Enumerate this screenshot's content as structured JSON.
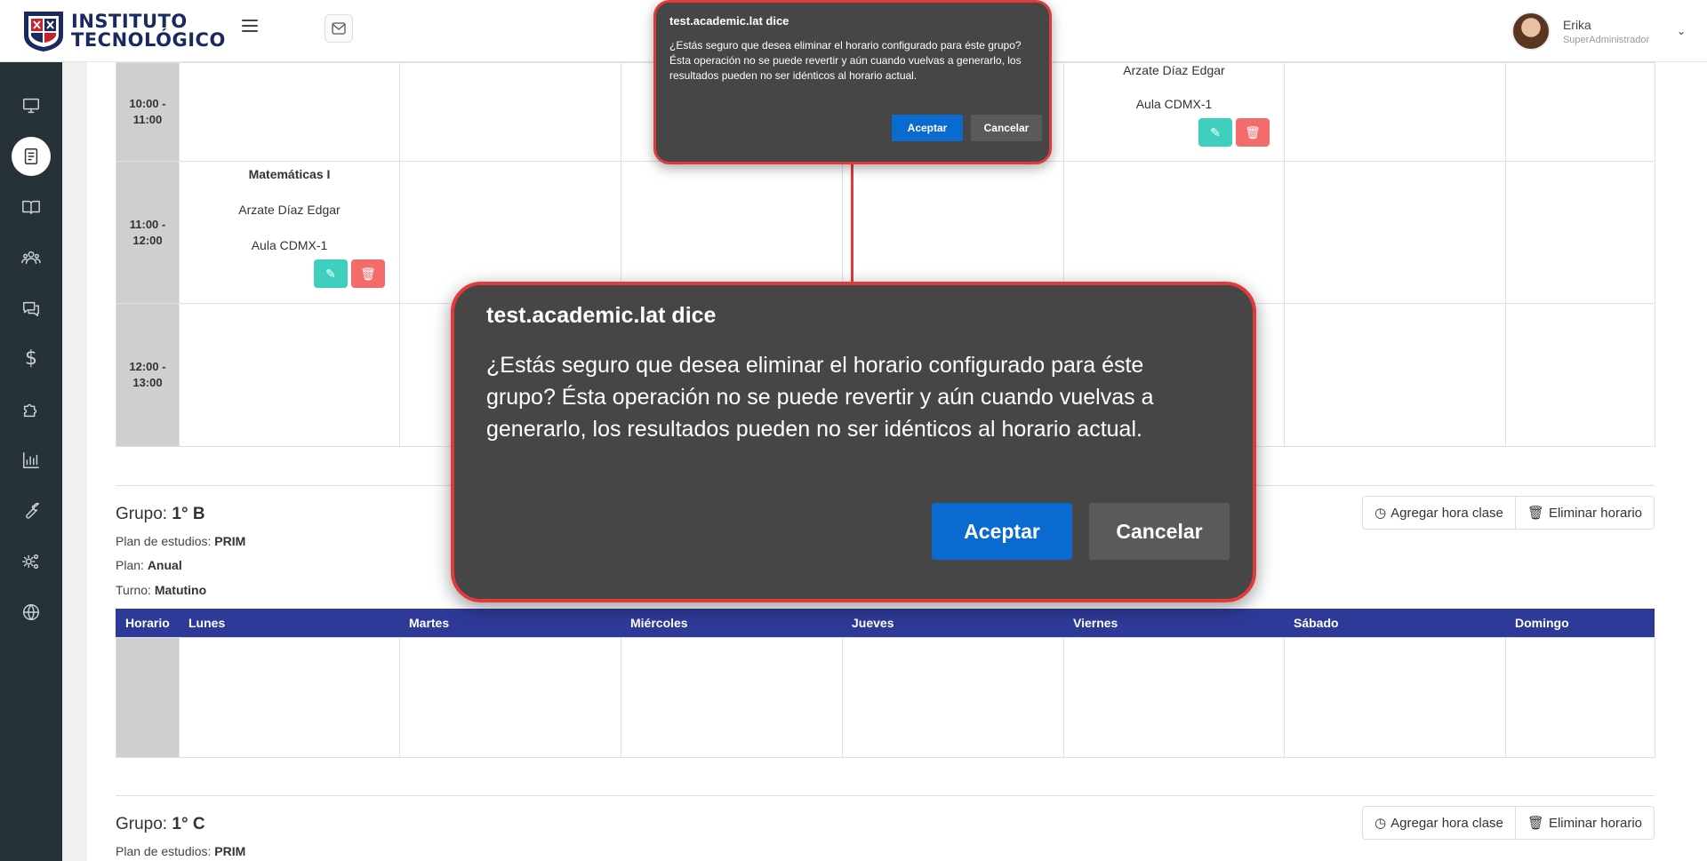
{
  "brand": {
    "line1": "INSTITUTO",
    "line2": "TECNOLÓGICO"
  },
  "user": {
    "name": "Erika",
    "role": "SuperAdministrador"
  },
  "sidebar": {
    "items": [
      {
        "icon": "monitor-icon"
      },
      {
        "icon": "book-icon",
        "active": true
      },
      {
        "icon": "open-book-icon"
      },
      {
        "icon": "users-icon"
      },
      {
        "icon": "chat-icon"
      },
      {
        "icon": "dollar-icon"
      },
      {
        "icon": "puzzle-icon"
      },
      {
        "icon": "bar-chart-icon"
      },
      {
        "icon": "wrench-icon"
      },
      {
        "icon": "settings-icon"
      },
      {
        "icon": "globe-icon"
      }
    ],
    "dollar_glyph": "$"
  },
  "schedule_top": {
    "rows": [
      {
        "time": "10:00 - 11:00",
        "friday": {
          "teacher": "Arzate Díaz Edgar",
          "room": "Aula CDMX-1"
        }
      },
      {
        "time": "11:00 - 12:00",
        "monday": {
          "subject": "Matemáticas I",
          "teacher": "Arzate Díaz Edgar",
          "room": "Aula CDMX-1"
        }
      },
      {
        "time": "12:00 - 13:00"
      }
    ]
  },
  "groups": [
    {
      "label": "Grupo:",
      "name": "1° B",
      "plan_estudios_label": "Plan de estudios:",
      "plan_estudios": "PRIM",
      "plan_label": "Plan:",
      "plan": "Anual",
      "turno_label": "Turno:",
      "turno": "Matutino",
      "add_button": "Agregar hora clase",
      "delete_button": "Eliminar horario"
    },
    {
      "label": "Grupo:",
      "name": "1° C",
      "plan_estudios_label": "Plan de estudios:",
      "plan_estudios": "PRIM",
      "add_button": "Agregar hora clase",
      "delete_button": "Eliminar horario"
    }
  ],
  "table_headers": [
    "Horario",
    "Lunes",
    "Martes",
    "Miércoles",
    "Jueves",
    "Viernes",
    "Sábado",
    "Domingo"
  ],
  "dialog": {
    "title": "test.academic.lat dice",
    "message": "¿Estás seguro que desea eliminar el horario configurado para éste grupo? Ésta operación no se puede revertir y aún cuando vuelvas a generarlo, los resultados pueden no ser idénticos al horario actual.",
    "accept": "Aceptar",
    "cancel": "Cancelar"
  },
  "colors": {
    "header_blue": "#2e3a97",
    "accent_red": "#e13a3a",
    "dialog_bg": "#464646",
    "accept_blue": "#0a6ad0",
    "sidebar_bg": "#263238"
  }
}
